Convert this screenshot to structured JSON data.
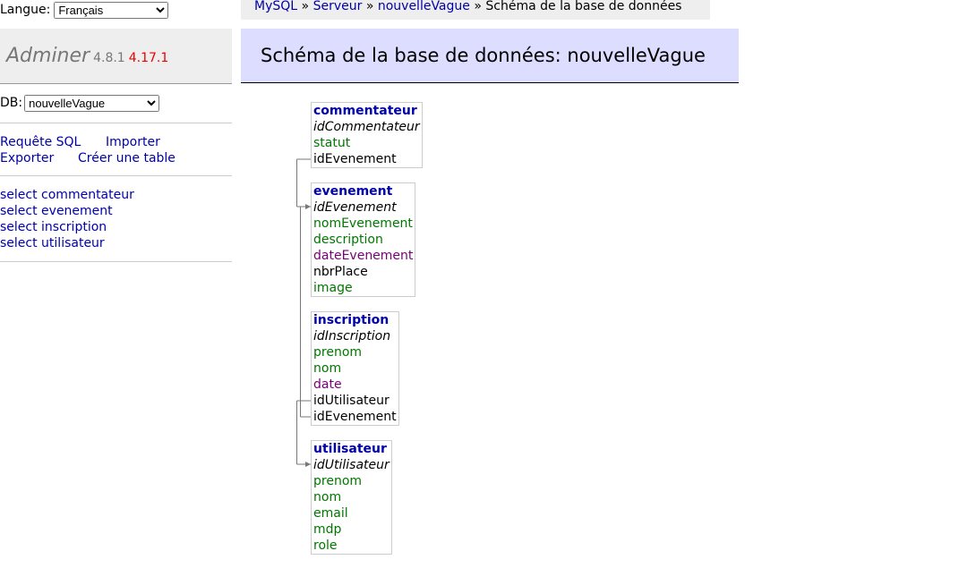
{
  "language": {
    "label": "Langue:",
    "selected": "Français"
  },
  "brand": {
    "name": "Adminer",
    "version": "4.8.1",
    "new_version": "4.17.1"
  },
  "db": {
    "label": "DB:",
    "selected": "nouvelleVague"
  },
  "actions": {
    "sql": "Requête SQL",
    "import": "Importer",
    "export": "Exporter",
    "create": "Créer une table"
  },
  "table_links": [
    "select commentateur",
    "select evenement",
    "select inscription",
    "select utilisateur"
  ],
  "breadcrumb": {
    "items": [
      "MySQL",
      "Serveur",
      "nouvelleVague"
    ],
    "sep": "»",
    "current": "Schéma de la base de données"
  },
  "title": "Schéma de la base de données: nouvelleVague",
  "schema": {
    "tables": [
      {
        "name": "commentateur",
        "columns": [
          {
            "name": "idCommentateur",
            "kind": "pk"
          },
          {
            "name": "statut",
            "kind": "text"
          },
          {
            "name": "idEvenement",
            "kind": "int"
          }
        ]
      },
      {
        "name": "evenement",
        "columns": [
          {
            "name": "idEvenement",
            "kind": "pk"
          },
          {
            "name": "nomEvenement",
            "kind": "text"
          },
          {
            "name": "description",
            "kind": "text"
          },
          {
            "name": "dateEvenement",
            "kind": "date"
          },
          {
            "name": "nbrPlace",
            "kind": "int"
          },
          {
            "name": "image",
            "kind": "text"
          }
        ]
      },
      {
        "name": "inscription",
        "columns": [
          {
            "name": "idInscription",
            "kind": "pk"
          },
          {
            "name": "prenom",
            "kind": "text"
          },
          {
            "name": "nom",
            "kind": "text"
          },
          {
            "name": "date",
            "kind": "date"
          },
          {
            "name": "idUtilisateur",
            "kind": "int"
          },
          {
            "name": "idEvenement",
            "kind": "int"
          }
        ]
      },
      {
        "name": "utilisateur",
        "columns": [
          {
            "name": "idUtilisateur",
            "kind": "pk"
          },
          {
            "name": "prenom",
            "kind": "text"
          },
          {
            "name": "nom",
            "kind": "text"
          },
          {
            "name": "email",
            "kind": "text"
          },
          {
            "name": "mdp",
            "kind": "text"
          },
          {
            "name": "role",
            "kind": "text"
          }
        ]
      }
    ]
  },
  "colors": {
    "text": "#007700",
    "date": "#770077",
    "link": "#0000aa",
    "header_bg": "#ddddff",
    "new_version": "#ee0000"
  }
}
